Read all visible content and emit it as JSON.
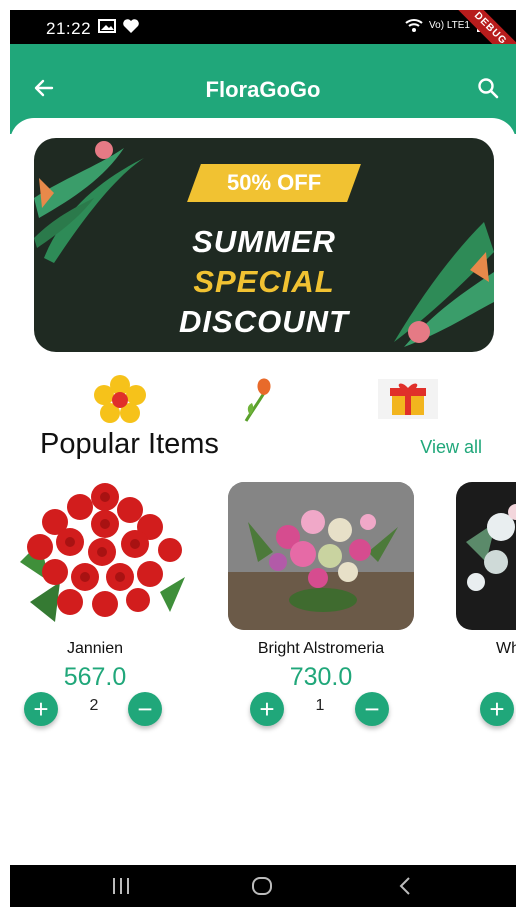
{
  "status_bar": {
    "time": "21:22",
    "network": "Vo) LTE1",
    "debug_label": "DEBUG"
  },
  "app_bar": {
    "title": "FloraGoGo"
  },
  "banner": {
    "offer": "50% OFF",
    "line1": "SUMMER",
    "line2": "SPECIAL",
    "line3": "DISCOUNT"
  },
  "categories": [
    {
      "icon": "flower-icon"
    },
    {
      "icon": "tulip-icon"
    },
    {
      "icon": "gift-icon"
    }
  ],
  "popular": {
    "title": "Popular Items",
    "view_all": "View all",
    "items": [
      {
        "name": "Jannien",
        "price": "567.0",
        "qty": "2"
      },
      {
        "name": "Bright Alstromeria",
        "price": "730.0",
        "qty": "1"
      },
      {
        "name": "Wh",
        "price": "",
        "qty": ""
      }
    ]
  },
  "colors": {
    "primary": "#20a77a",
    "banner_bg": "#1f2a22",
    "offer_yellow": "#f1c232"
  }
}
